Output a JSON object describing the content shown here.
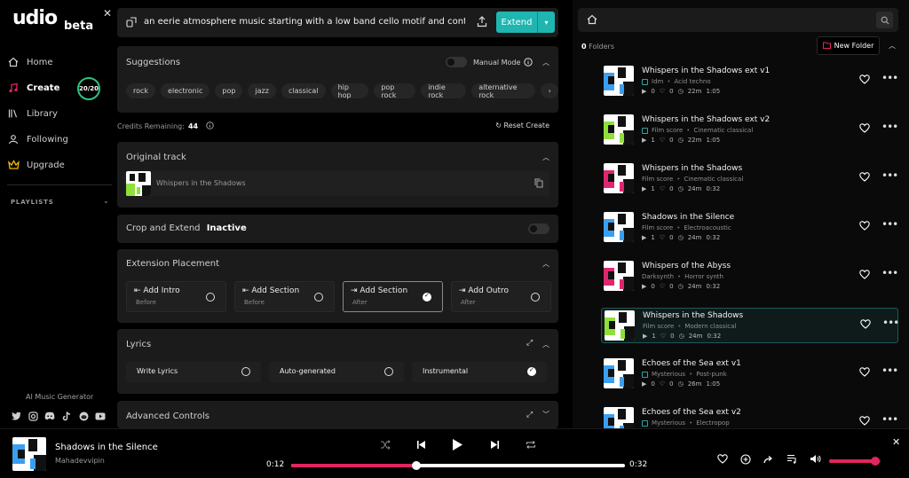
{
  "brand": {
    "logo": "udio",
    "beta": "beta"
  },
  "sidebar": {
    "items": [
      {
        "label": "Home",
        "icon": "home-icon"
      },
      {
        "label": "Create",
        "icon": "music-note-icon",
        "active": true
      },
      {
        "label": "Library",
        "icon": "library-icon"
      },
      {
        "label": "Following",
        "icon": "user-icon"
      },
      {
        "label": "Upgrade",
        "icon": "crown-icon"
      }
    ],
    "credits_badge": "20/20",
    "playlists_label": "PLAYLISTS",
    "ai_generator": "AI Music Generator",
    "socials": [
      "twitter-icon",
      "instagram-icon",
      "discord-icon",
      "tiktok-icon",
      "reddit-icon",
      "youtube-icon"
    ]
  },
  "prompt": {
    "text": "an eerie atmosphere music starting with a low band cello motif and contin",
    "extend_label": "Extend"
  },
  "suggestions": {
    "title": "Suggestions",
    "manual_mode": "Manual Mode",
    "chips": [
      "rock",
      "electronic",
      "pop",
      "jazz",
      "classical",
      "hip hop",
      "pop rock",
      "indie rock",
      "alternative rock"
    ]
  },
  "credits": {
    "label": "Credits Remaining:",
    "value": "44",
    "reset": "Reset Create"
  },
  "original_track": {
    "title": "Original track",
    "track_name": "Whispers in the Shadows"
  },
  "crop": {
    "label": "Crop and Extend",
    "status": "Inactive"
  },
  "placement": {
    "title": "Extension Placement",
    "options": [
      {
        "title": "Add Intro",
        "sub": "Before",
        "icon": "⇤",
        "checked": false
      },
      {
        "title": "Add Section",
        "sub": "Before",
        "icon": "⇤",
        "checked": false
      },
      {
        "title": "Add Section",
        "sub": "After",
        "icon": "⇥",
        "checked": true
      },
      {
        "title": "Add Outro",
        "sub": "After",
        "icon": "⇥",
        "checked": false
      }
    ]
  },
  "lyrics": {
    "title": "Lyrics",
    "options": [
      {
        "title": "Write Lyrics",
        "checked": false
      },
      {
        "title": "Auto-generated",
        "checked": false
      },
      {
        "title": "Instrumental",
        "checked": true
      }
    ]
  },
  "advanced": {
    "title": "Advanced Controls"
  },
  "library": {
    "folders_count": "0",
    "folders_label": "Folders",
    "new_folder": "New Folder",
    "songs": [
      {
        "title": "Whispers in the Shadows ext v1",
        "genre": "Idm",
        "subgenre": "Acid techno",
        "plays": "0",
        "likes": "0",
        "age": "22m",
        "duration": "1:05",
        "badge": true,
        "accent": "#3a9ff0",
        "selected": false
      },
      {
        "title": "Whispers in the Shadows ext v2",
        "genre": "Film score",
        "subgenre": "Cinematic classical",
        "plays": "1",
        "likes": "0",
        "age": "22m",
        "duration": "1:05",
        "badge": true,
        "accent": "#8fe03a",
        "selected": false
      },
      {
        "title": "Whispers in the Shadows",
        "genre": "Film score",
        "subgenre": "Cinematic classical",
        "plays": "1",
        "likes": "0",
        "age": "24m",
        "duration": "0:32",
        "badge": false,
        "accent": "#e0266f",
        "selected": false
      },
      {
        "title": "Shadows in the Silence",
        "genre": "Film score",
        "subgenre": "Electroacoustic",
        "plays": "1",
        "likes": "0",
        "age": "24m",
        "duration": "0:32",
        "badge": false,
        "accent": "#3a9ff0",
        "selected": false
      },
      {
        "title": "Whispers of the Abyss",
        "genre": "Darksynth",
        "subgenre": "Horror synth",
        "plays": "0",
        "likes": "0",
        "age": "24m",
        "duration": "0:32",
        "badge": false,
        "accent": "#e0266f",
        "selected": false
      },
      {
        "title": "Whispers in the Shadows",
        "genre": "Film score",
        "subgenre": "Modern classical",
        "plays": "1",
        "likes": "0",
        "age": "24m",
        "duration": "0:32",
        "badge": false,
        "accent": "#8fe03a",
        "selected": true
      },
      {
        "title": "Echoes of the Sea ext v1",
        "genre": "Mysterious",
        "subgenre": "Post-punk",
        "plays": "0",
        "likes": "0",
        "age": "26m",
        "duration": "1:05",
        "badge": true,
        "accent": "#3a9ff0",
        "selected": false
      },
      {
        "title": "Echoes of the Sea ext v2",
        "genre": "Mysterious",
        "subgenre": "Electropop",
        "plays": "",
        "likes": "",
        "age": "",
        "duration": "",
        "badge": true,
        "accent": "#3a9ff0",
        "selected": false
      }
    ]
  },
  "player": {
    "title": "Shadows in the Silence",
    "artist": "Mahadevvipin",
    "current": "0:12",
    "total": "0:32",
    "progress": 0.375,
    "volume": 0.9
  },
  "colors": {
    "accent_teal": "#1fb5b0",
    "progress_pink": "#e02661",
    "credits_green": "#2ec27e"
  }
}
